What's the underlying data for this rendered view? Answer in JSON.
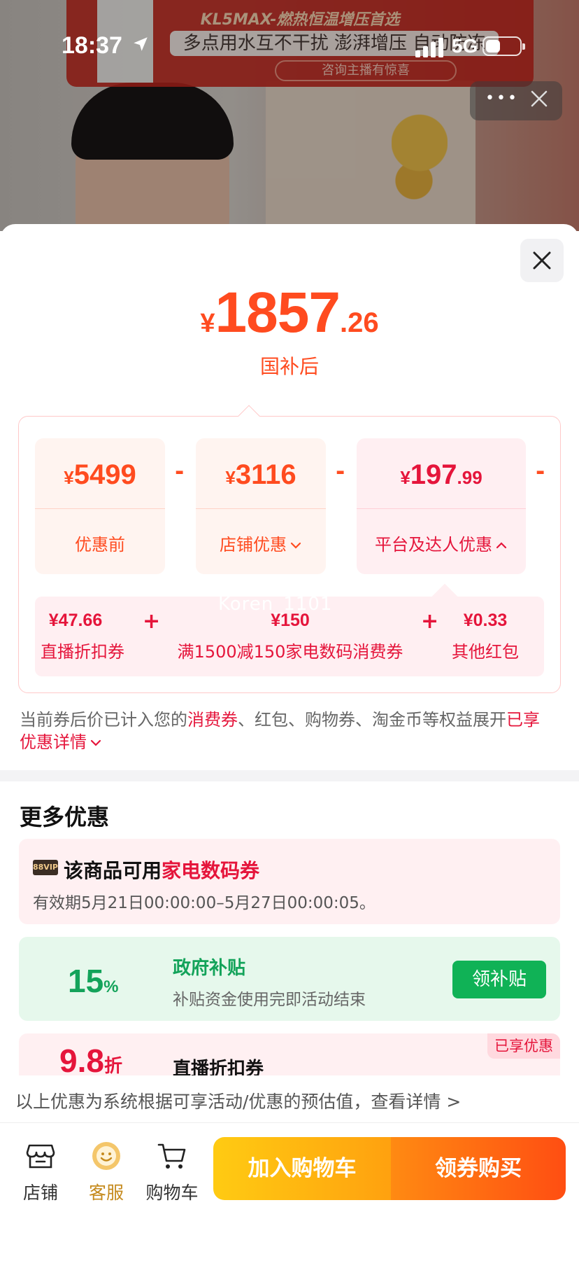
{
  "status_bar": {
    "time": "18:37",
    "network": "5G"
  },
  "video_banner": {
    "headline": "KL5MAX-燃热恒温增压首选",
    "subline": "多点用水互不干扰 澎湃增压 自动防冻",
    "cta": "咨询主播有惊喜"
  },
  "price": {
    "currency": "¥",
    "integer": "1857",
    "decimal": ".26",
    "label": "国补后"
  },
  "breakdown": {
    "cards": [
      {
        "currency": "¥",
        "integer": "5499",
        "decimal": "",
        "label": "优惠前"
      },
      {
        "currency": "¥",
        "integer": "3116",
        "decimal": "",
        "label": "店铺优惠"
      },
      {
        "currency": "¥",
        "integer": "197",
        "decimal": ".99",
        "label": "平台及达人优惠"
      }
    ],
    "operator": "-",
    "plus": "+",
    "watermark": "Koren_1101",
    "sub_items": [
      {
        "amount": "¥47.66",
        "label": "直播折扣券"
      },
      {
        "amount": "¥150",
        "label": "满1500减150家电数码消费券"
      },
      {
        "amount": "¥0.33",
        "label": "其他红包"
      }
    ]
  },
  "note": {
    "prefix": "当前券后价已计入您的",
    "highlight": "消费券",
    "middle": "、红包、购物券、淘金币等权益展开",
    "link": "已享优惠详情"
  },
  "more_offers": {
    "title": "更多优惠",
    "coupon": {
      "vip": "88VIP",
      "title_prefix": "该商品可用",
      "title_highlight": "家电数码券",
      "validity": "有效期5月21日00:00:00–5月27日00:00:05。"
    },
    "subsidy": {
      "value": "15",
      "unit": "%",
      "title": "政府补贴",
      "desc": "补贴资金使用完即活动结束",
      "button": "领补贴"
    },
    "discount": {
      "value": "9.8",
      "unit": "折",
      "title": "直播折扣券",
      "badge": "已享优惠"
    }
  },
  "footnote": "以上优惠为系统根据可享活动/优惠的预估值，查看详情 >",
  "bottom_bar": {
    "nav": [
      {
        "label": "店铺",
        "icon": "store-icon"
      },
      {
        "label": "客服",
        "icon": "customer-service-icon"
      },
      {
        "label": "购物车",
        "icon": "cart-icon"
      }
    ],
    "add_to_cart": "加入购物车",
    "buy": "领券购买"
  },
  "colors": {
    "orange": "#ff4b1f",
    "red": "#e5153b",
    "green": "#13a35a"
  }
}
